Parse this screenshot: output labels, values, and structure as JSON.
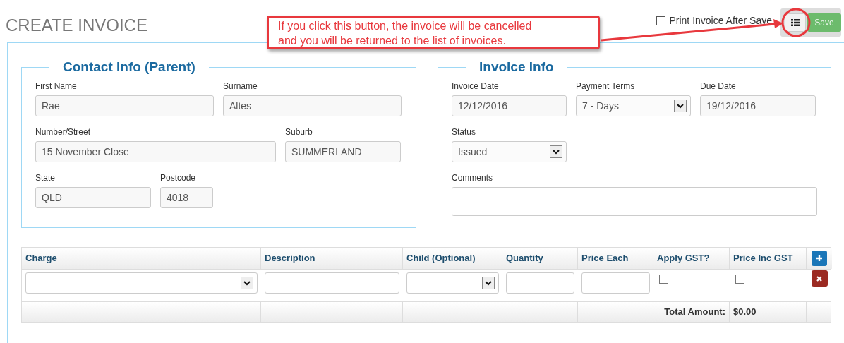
{
  "page_title": "CREATE INVOICE",
  "print_after_save": {
    "label": "Print Invoice After Save",
    "checked": false
  },
  "toolbar_buttons": [
    {
      "kind": "list"
    },
    {
      "kind": "save",
      "label": "Save"
    }
  ],
  "annotation": {
    "text": "If you click this button, the invoice will be cancelled\nand you will be returned to the list of invoices."
  },
  "contact_info": {
    "title": "Contact Info (Parent)",
    "rows": [
      [
        {
          "label": "First Name",
          "value": "Rae",
          "kind": "text"
        },
        {
          "label": "Surname",
          "value": "Altes",
          "kind": "text"
        }
      ],
      [
        {
          "label": "Number/Street",
          "value": "15 November Close",
          "kind": "text"
        },
        {
          "label": "Suburb",
          "value": "SUMMERLAND",
          "kind": "text"
        }
      ],
      [
        {
          "label": "State",
          "value": "QLD",
          "kind": "text"
        },
        {
          "label": "Postcode",
          "value": "4018",
          "kind": "text"
        }
      ]
    ]
  },
  "invoice_info": {
    "title": "Invoice Info",
    "rows": [
      [
        {
          "label": "Invoice Date",
          "value": "12/12/2016",
          "kind": "text"
        },
        {
          "label": "Payment Terms",
          "value": "7 - Days",
          "kind": "select"
        },
        {
          "label": "Due Date",
          "value": "19/12/2016",
          "kind": "text"
        }
      ],
      [
        {
          "label": "Status",
          "value": "Issued",
          "kind": "select"
        }
      ],
      [
        {
          "label": "Comments",
          "kind": "textarea"
        }
      ]
    ]
  },
  "charges_table": {
    "columns": [
      "Charge",
      "Description",
      "Child (Optional)",
      "Quantity",
      "Price Each",
      "Apply GST?",
      "Price Inc GST"
    ],
    "add_button": {
      "kind": "add"
    },
    "rows": [
      {
        "cells": [
          {
            "kind": "select"
          },
          {
            "kind": "text"
          },
          {
            "kind": "select"
          },
          {
            "kind": "text"
          },
          {
            "kind": "text"
          },
          {
            "kind": "checkbox",
            "checked": false
          },
          {
            "kind": "checkbox",
            "checked": false
          },
          {
            "kind": "delete"
          }
        ]
      }
    ],
    "footer": {
      "total_label": "Total Amount:",
      "total_value": "$0.00"
    }
  }
}
